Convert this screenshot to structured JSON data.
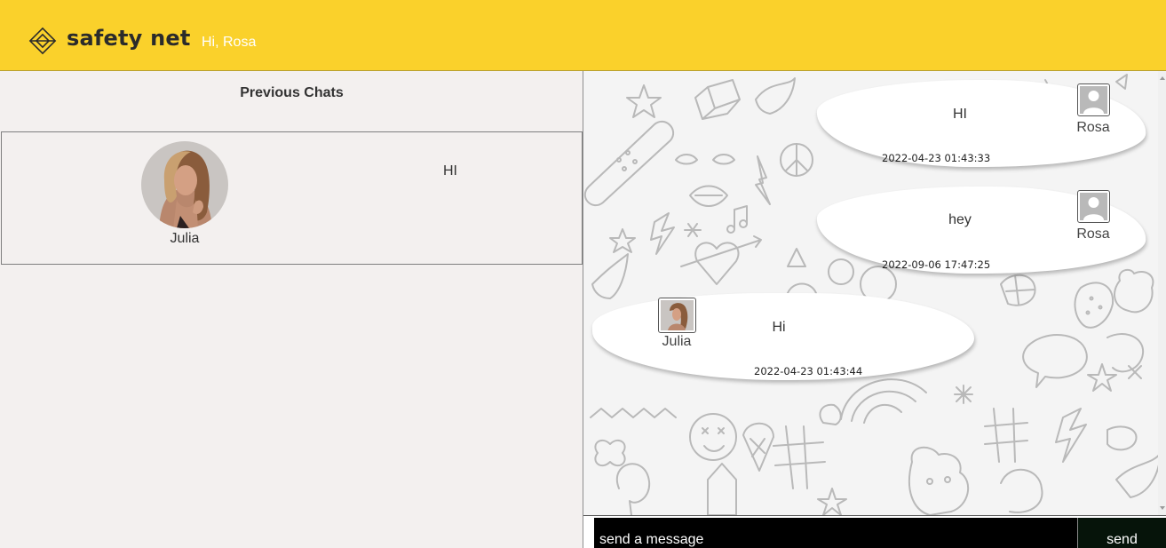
{
  "header": {
    "brand": "safety net",
    "greeting": "Hi, Rosa",
    "icons": {
      "logo": "diamond-logo-icon"
    }
  },
  "sidebar": {
    "title": "Previous Chats",
    "chats": [
      {
        "name": "Julia",
        "last_message": "HI",
        "avatar": "julia-photo"
      }
    ]
  },
  "conversation": {
    "messages": [
      {
        "sender": "Rosa",
        "text": "HI",
        "timestamp": "2022-04-23 01:43:33",
        "side": "right",
        "avatar": "default-user-icon"
      },
      {
        "sender": "Rosa",
        "text": "hey",
        "timestamp": "2022-09-06 17:47:25",
        "side": "right",
        "avatar": "default-user-icon"
      },
      {
        "sender": "Julia",
        "text": "Hi",
        "timestamp": "2022-04-23 01:43:44",
        "side": "left",
        "avatar": "julia-photo"
      }
    ]
  },
  "composer": {
    "placeholder": "send a message",
    "send_label": "send"
  },
  "colors": {
    "header_bg": "#fad12b",
    "panel_bg": "#f3f0ef",
    "input_bg": "#000000",
    "send_bg": "#06140a"
  }
}
